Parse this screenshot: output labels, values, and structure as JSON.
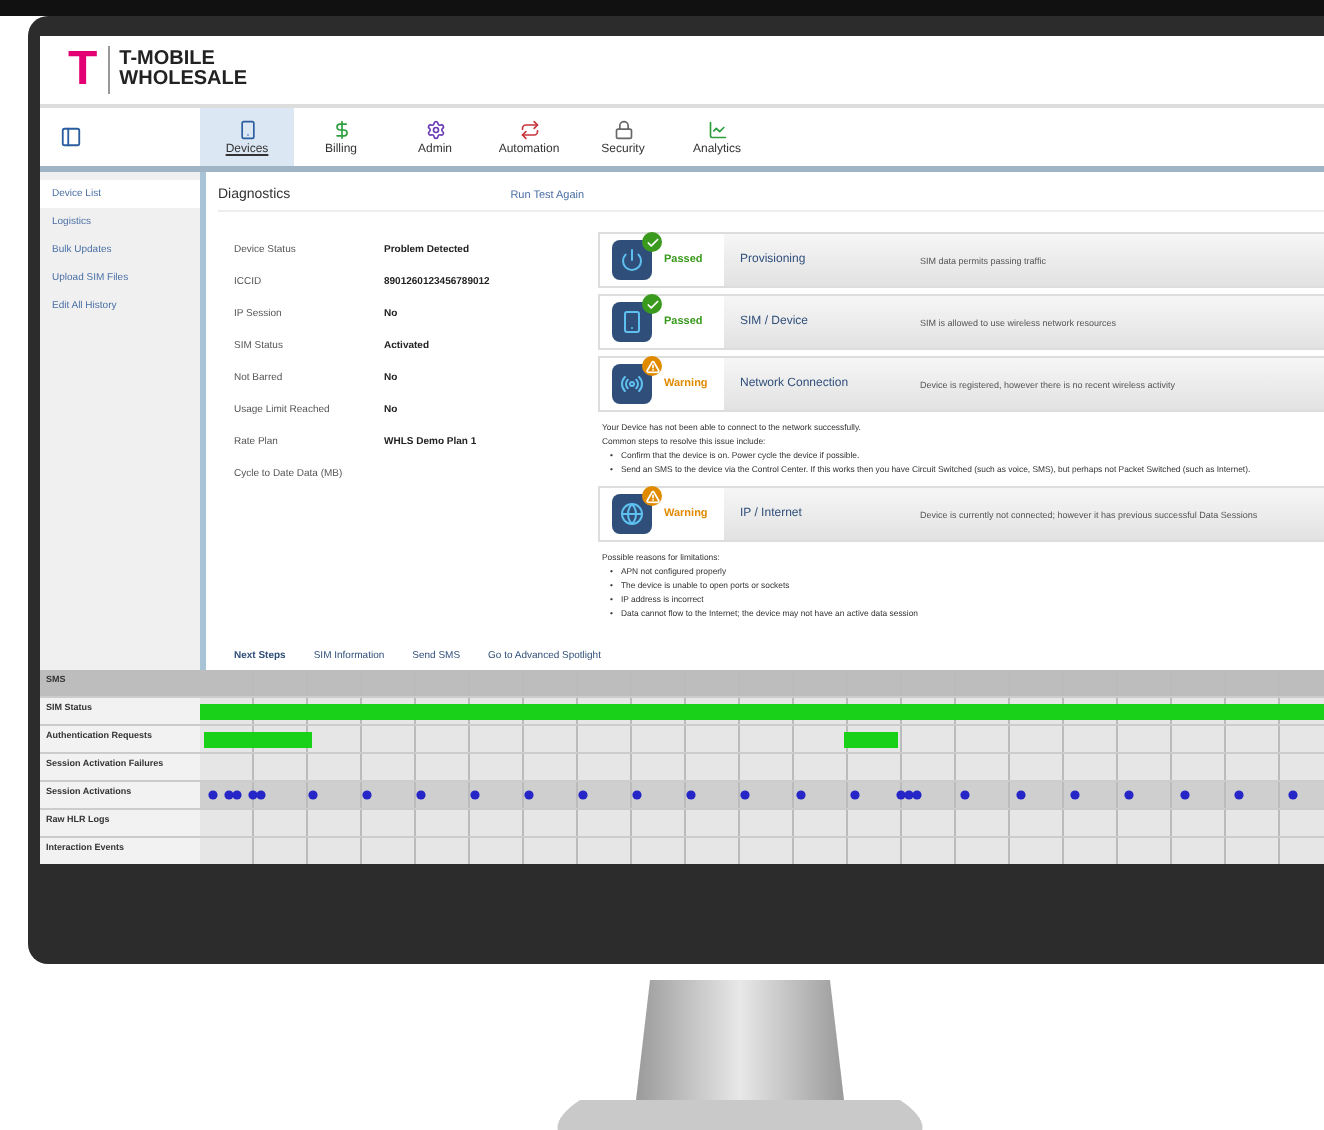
{
  "header": {
    "brand_mark": "T",
    "brand_line_1": "T-MOBILE",
    "brand_line_2": "WHOLESALE"
  },
  "nav_tabs": [
    {
      "label": "Devices",
      "selected": true
    },
    {
      "label": "Billing",
      "selected": false
    },
    {
      "label": "Admin",
      "selected": false
    },
    {
      "label": "Automation",
      "selected": false
    },
    {
      "label": "Security",
      "selected": false
    },
    {
      "label": "Analytics",
      "selected": false
    }
  ],
  "sidebar": {
    "items": [
      {
        "label": "Device List",
        "selected": true
      },
      {
        "label": "Logistics",
        "selected": false
      },
      {
        "label": "Bulk Updates",
        "selected": false
      },
      {
        "label": "Upload SIM Files",
        "selected": false
      },
      {
        "label": "Edit All History",
        "selected": false
      }
    ]
  },
  "diagnostics": {
    "title": "Diagnostics",
    "action": "Run Test Again",
    "fields": [
      {
        "label": "Device Status",
        "value": "Problem Detected"
      },
      {
        "label": "ICCID",
        "value": "8901260123456789012"
      },
      {
        "label": "IP Session",
        "value": "No"
      },
      {
        "label": "SIM Status",
        "value": "Activated"
      },
      {
        "label": "Not Barred",
        "value": "No"
      },
      {
        "label": "Usage Limit Reached",
        "value": "No"
      },
      {
        "label": "Rate Plan",
        "value": "WHLS Demo Plan 1"
      },
      {
        "label": "Cycle to Date Data (MB)"
      }
    ],
    "checks": [
      {
        "kind": "passed",
        "status": "Passed",
        "name": "Provisioning",
        "description": "SIM data permits passing traffic"
      },
      {
        "kind": "passed",
        "status": "Passed",
        "name": "SIM / Device",
        "description": "SIM is allowed to use wireless network resources"
      },
      {
        "kind": "warning",
        "status": "Warning",
        "name": "Network Connection",
        "description": "Device is registered, however there is no recent wireless activity",
        "notes": [
          "Your Device has not been able to connect to the network successfully.",
          "Common steps to resolve this issue include:"
        ],
        "bullets": [
          {
            "marker": "•",
            "text": "Confirm that the device is on. Power cycle the device if possible."
          },
          {
            "marker": "•",
            "text": "Send an SMS to the device via the Control Center. If this works then you have Circuit Switched (such as voice, SMS), but perhaps not Packet Switched (such as Internet)."
          }
        ]
      },
      {
        "kind": "warning",
        "status": "Warning",
        "name": "IP / Internet",
        "description": "Device is currently not connected; however it has previous successful Data Sessions",
        "notes": [
          "Possible reasons for limitations:"
        ],
        "bullets": [
          {
            "marker": "•",
            "text": "APN not configured properly"
          },
          {
            "marker": "•",
            "text": "The device is unable to open ports or sockets"
          },
          {
            "marker": "•",
            "text": "IP address is incorrect"
          },
          {
            "marker": "•",
            "text": "Data cannot flow to the Internet; the device may not have an active data session"
          }
        ]
      }
    ],
    "bottom_tabs": [
      {
        "label": "Next Steps",
        "selected": true
      },
      {
        "label": "SIM Information",
        "selected": false
      },
      {
        "label": "Send SMS",
        "selected": false
      },
      {
        "label": "Go to Advanced Spotlight",
        "selected": false
      }
    ]
  },
  "timeline": {
    "rows": [
      {
        "label": "SMS",
        "kind": "header"
      },
      {
        "label": "SIM Status",
        "kind": "status"
      },
      {
        "label": "Authentication Requests",
        "kind": "requests"
      },
      {
        "label": "Session Activation Failures",
        "kind": "empty"
      },
      {
        "label": "Session Activations",
        "kind": "dots"
      },
      {
        "label": "Raw HLR Logs",
        "kind": "empty"
      },
      {
        "label": "Interaction Events",
        "kind": "empty"
      }
    ]
  }
}
